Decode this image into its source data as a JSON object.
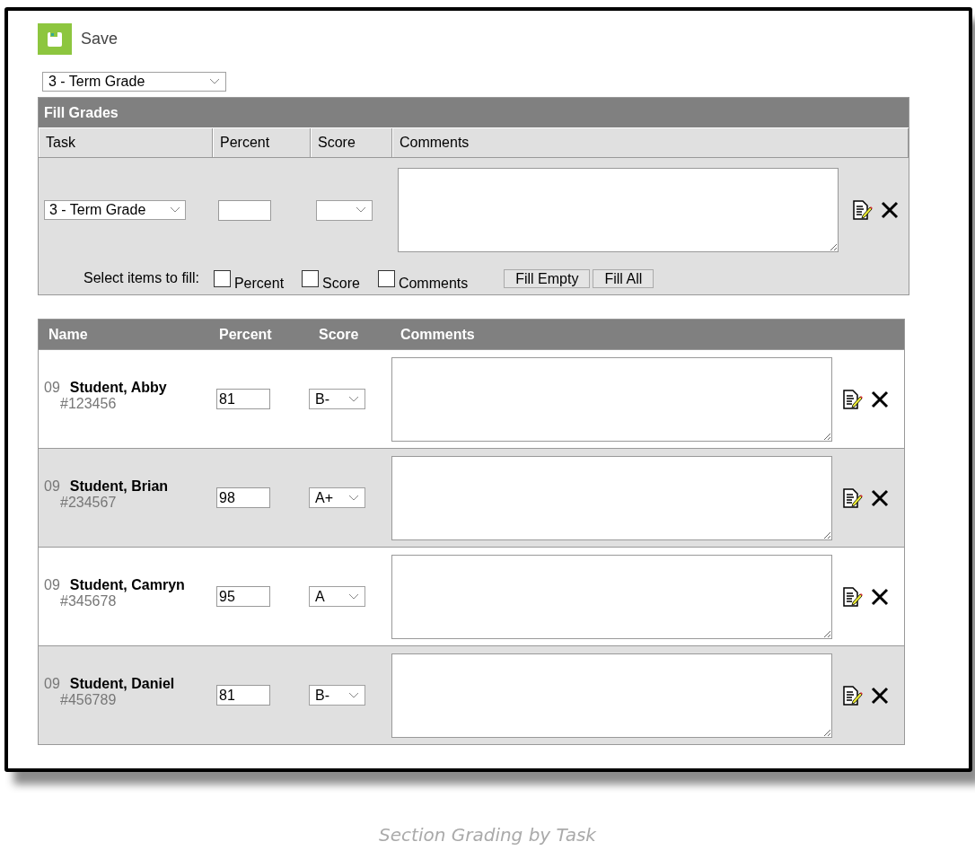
{
  "toolbar": {
    "save_label": "Save"
  },
  "task_select": {
    "value": "3 - Term Grade"
  },
  "fill_grades": {
    "title": "Fill Grades",
    "columns": [
      "Task",
      "Percent",
      "Score",
      "Comments"
    ],
    "task": "3 - Term Grade",
    "select_label": "Select items to fill:",
    "options": [
      {
        "label": "Percent",
        "checked": false
      },
      {
        "label": "Score",
        "checked": false
      },
      {
        "label": "Comments",
        "checked": false
      }
    ],
    "buttons": [
      "Fill Empty",
      "Fill All"
    ]
  },
  "grades": {
    "columns": [
      "Name",
      "Percent",
      "Score",
      "Comments"
    ],
    "rows": [
      {
        "grade": "09",
        "name": "Student, Abby",
        "id": "#123456",
        "percent": "81",
        "score": "B-"
      },
      {
        "grade": "09",
        "name": "Student, Brian",
        "id": "#234567",
        "percent": "98",
        "score": "A+"
      },
      {
        "grade": "09",
        "name": "Student, Camryn",
        "id": "#345678",
        "percent": "95",
        "score": "A"
      },
      {
        "grade": "09",
        "name": "Student, Daniel",
        "id": "#456789",
        "percent": "81",
        "score": "B-"
      }
    ]
  },
  "caption": "Section Grading by Task"
}
